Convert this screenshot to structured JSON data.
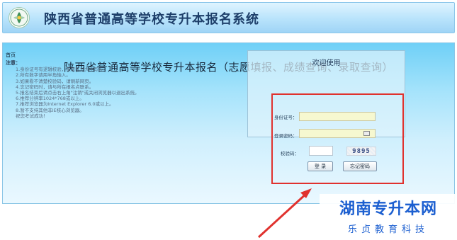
{
  "header": {
    "title": "陕西省普通高等学校专升本报名系统"
  },
  "main": {
    "home_link": "首页",
    "title": "陕西省普通高等学校专升本报名（志愿填报、成绩查询、录取查询）"
  },
  "notice": {
    "title": "注意：",
    "items": [
      "1.身份证号有逻辑校验，末尾区分大小写X。",
      "2.所有数字请用半角输入。",
      "3.如果看不清楚校验码，请刷新网页。",
      "4.忘记密码时，请与所在报名点联系。",
      "5.报名结束后请点击右上角\"注销\"或关闭浏览器以退出系统。",
      "6.推荐分辨率1024*768或以上。",
      "7.推荐浏览器为Internet Explorer 6.0或以上。",
      "8.暂不支持其他非IE核心浏览器。"
    ],
    "wish": "祝您考试成功！"
  },
  "login": {
    "welcome": "欢迎使用",
    "id_label": "身份证号：",
    "id_value": "",
    "password_label": "登录密码：",
    "password_value": "",
    "captcha_label": "校验码：",
    "captcha_value": "",
    "captcha_code": "9895",
    "login_button": "登 录",
    "forgot_button": "忘记密码"
  },
  "watermark": {
    "title": "湖南专升本网",
    "subtitle": "乐贞教育科技"
  },
  "colors": {
    "highlight": "#e0322e",
    "watermark": "#1c5fd0"
  }
}
